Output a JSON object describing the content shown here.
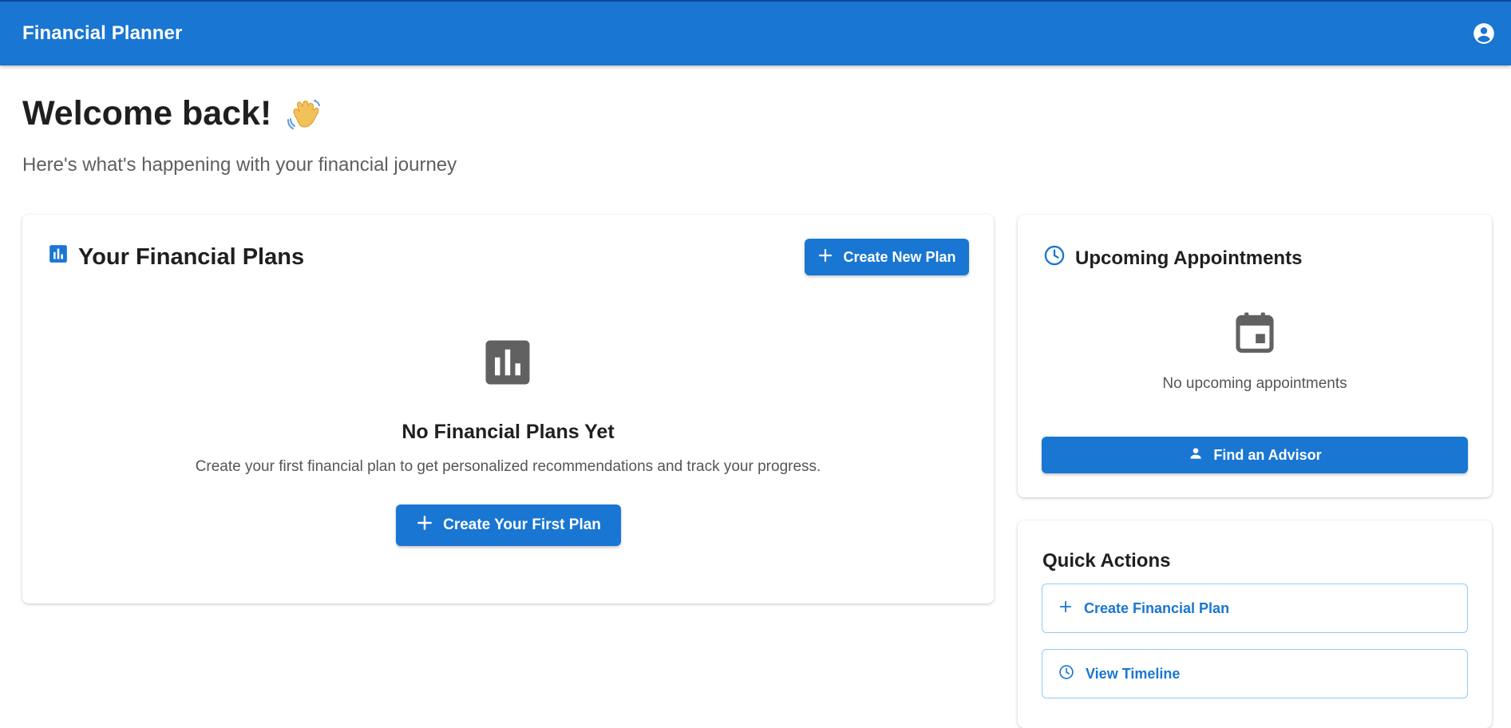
{
  "app": {
    "title": "Financial Planner",
    "account_icon": "account-circle-icon"
  },
  "welcome": {
    "title": "Welcome back!",
    "emoji_icon": "waving-hand-icon",
    "subtitle": "Here's what's happening with your financial journey"
  },
  "plans": {
    "title": "Your Financial Plans",
    "header_icon": "bar-chart-icon",
    "create_new_label": "Create New Plan",
    "empty_icon": "bar-chart-icon",
    "empty_title": "No Financial Plans Yet",
    "empty_text": "Create your first financial plan to get personalized recommendations and track your progress.",
    "create_first_label": "Create Your First Plan"
  },
  "appointments": {
    "title": "Upcoming Appointments",
    "header_icon": "clock-icon",
    "empty_icon": "calendar-icon",
    "empty_text": "No upcoming appointments",
    "find_advisor_label": "Find an Advisor"
  },
  "quick_actions": {
    "title": "Quick Actions",
    "items": [
      {
        "label": "Create Financial Plan",
        "icon": "plus-icon"
      },
      {
        "label": "View Timeline",
        "icon": "clock-icon"
      }
    ]
  },
  "colors": {
    "primary": "#1976d2",
    "outline": "#90caf9",
    "icon_gray": "#616161",
    "text_muted": "#5f5f5f"
  }
}
